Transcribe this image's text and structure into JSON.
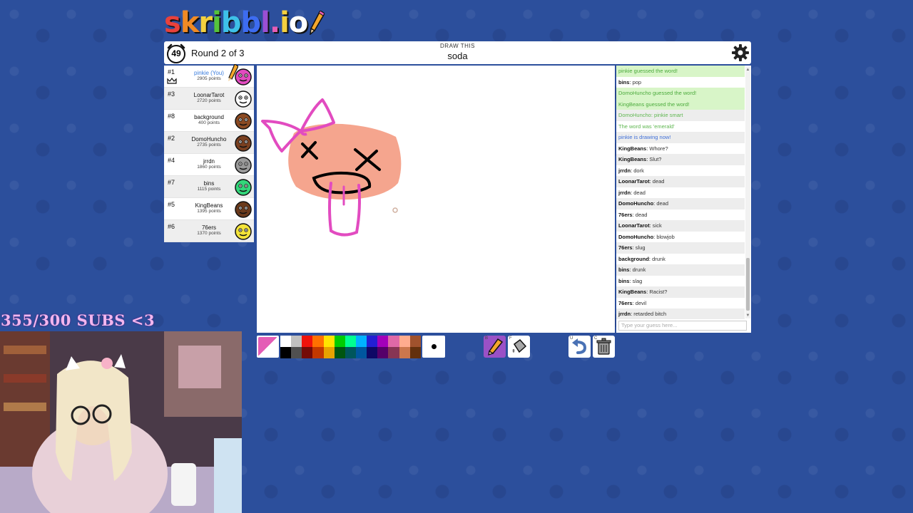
{
  "logo": {
    "letters": [
      {
        "ch": "s",
        "color": "#e8413c"
      },
      {
        "ch": "k",
        "color": "#f08a24"
      },
      {
        "ch": "r",
        "color": "#f4d03f"
      },
      {
        "ch": "i",
        "color": "#56c33a"
      },
      {
        "ch": "b",
        "color": "#3ec1e8"
      },
      {
        "ch": "b",
        "color": "#3d6cf0"
      },
      {
        "ch": "l",
        "color": "#9a4fd4"
      },
      {
        "ch": ".",
        "color": "#e45db6"
      },
      {
        "ch": "i",
        "color": "#f4d03f"
      },
      {
        "ch": "o",
        "color": "#fff"
      }
    ]
  },
  "header": {
    "timer": "49",
    "round": "Round 2 of 3",
    "draw_label": "DRAW THIS",
    "word": "soda"
  },
  "players": [
    {
      "rank": "#1",
      "name": "pinkie (You)",
      "points": "2905 points",
      "avatar_color": "#e24bc0",
      "you": true,
      "drawing": true,
      "crown": true
    },
    {
      "rank": "#3",
      "name": "LoonarTarot",
      "points": "2720 points",
      "avatar_color": "#ffffff"
    },
    {
      "rank": "#8",
      "name": "background",
      "points": "400 points",
      "avatar_color": "#8b4a22"
    },
    {
      "rank": "#2",
      "name": "DomoHuncho",
      "points": "2735 points",
      "avatar_color": "#7a4020"
    },
    {
      "rank": "#4",
      "name": "jrrdn",
      "points": "1860 points",
      "avatar_color": "#9a9a9a"
    },
    {
      "rank": "#7",
      "name": "bins",
      "points": "1115 points",
      "avatar_color": "#33d67a"
    },
    {
      "rank": "#5",
      "name": "KingBeans",
      "points": "1395 points",
      "avatar_color": "#6a3a1c"
    },
    {
      "rank": "#6",
      "name": "76ers",
      "points": "1370 points",
      "avatar_color": "#f4e43a"
    }
  ],
  "chat": [
    {
      "text": "pinkie guessed the word!",
      "style": "green"
    },
    {
      "user": "bins",
      "text": "pop"
    },
    {
      "text": "DomoHuncho guessed the word!",
      "style": "green"
    },
    {
      "text": "KingBeans guessed the word!",
      "style": "green"
    },
    {
      "text": "DomoHuncho: pinkie smart",
      "style": "green-t"
    },
    {
      "text": "The word was 'emerald'",
      "style": "green-t"
    },
    {
      "text": "pinkie is drawing now!",
      "style": "blue"
    },
    {
      "user": "KingBeans",
      "text": "Whore?"
    },
    {
      "user": "KingBeans",
      "text": "Slut?"
    },
    {
      "user": "jrrdn",
      "text": "dork"
    },
    {
      "user": "LoonarTarot",
      "text": "dead"
    },
    {
      "user": "jrrdn",
      "text": "dead"
    },
    {
      "user": "DomoHuncho",
      "text": "dead"
    },
    {
      "user": "76ers",
      "text": "dead"
    },
    {
      "user": "LoonarTarot",
      "text": "sick"
    },
    {
      "user": "DomoHuncho",
      "text": "blowjob"
    },
    {
      "user": "76ers",
      "text": "slug"
    },
    {
      "user": "background",
      "text": "drunk"
    },
    {
      "user": "bins",
      "text": "drunk"
    },
    {
      "user": "bins",
      "text": "slag"
    },
    {
      "user": "KingBeans",
      "text": "Racist?"
    },
    {
      "user": "76ers",
      "text": "devil"
    },
    {
      "user": "jrrdn",
      "text": "retarded bitch"
    }
  ],
  "chat_input": {
    "placeholder": "Type your guess here..."
  },
  "palette": {
    "top": [
      "#ffffff",
      "#c1c1c1",
      "#ef130b",
      "#ff7100",
      "#ffe400",
      "#00cc00",
      "#00ff91",
      "#00b2ff",
      "#231fd3",
      "#a300ba",
      "#df69a7",
      "#ffac8e",
      "#a0522d"
    ],
    "bottom": [
      "#000000",
      "#505050",
      "#740b07",
      "#c23800",
      "#e8a200",
      "#005510",
      "#00565c",
      "#00569e",
      "#0e0865",
      "#550069",
      "#873554",
      "#cc774d",
      "#63300d"
    ]
  },
  "current_color": "#e45db6",
  "tools": {
    "pen_key": "B",
    "fill_key": "F",
    "undo_key": "U",
    "clear_key": "C"
  },
  "stream": {
    "subs": "355/300 SUBS <3"
  }
}
